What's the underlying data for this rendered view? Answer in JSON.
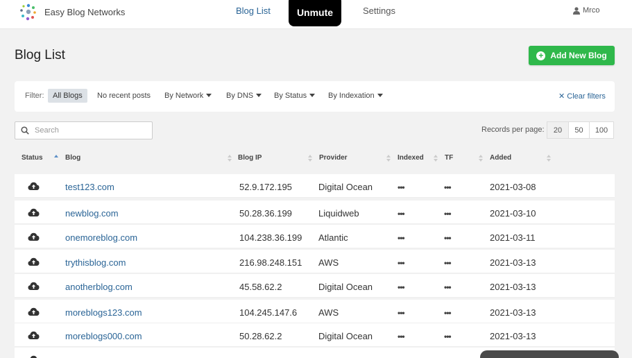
{
  "nav": {
    "brand": "Easy Blog Networks",
    "blog_list": "Blog List",
    "unmute": "Unmute",
    "settings": "Settings",
    "user": "Mrco"
  },
  "header": {
    "title": "Blog List",
    "add_button": "Add New Blog"
  },
  "filters": {
    "label": "Filter:",
    "all": "All Blogs",
    "no_recent": "No recent posts",
    "by_network": "By Network",
    "by_dns": "By DNS",
    "by_status": "By Status",
    "by_indexation": "By Indexation",
    "clear": "Clear filters"
  },
  "search": {
    "placeholder": "Search"
  },
  "records": {
    "label": "Records per page:",
    "options": [
      "20",
      "50",
      "100"
    ],
    "selected": "20"
  },
  "table": {
    "headers": {
      "status": "Status",
      "blog": "Blog",
      "ip": "Blog IP",
      "provider": "Provider",
      "indexed": "Indexed",
      "tf": "TF",
      "added": "Added"
    },
    "indexed_placeholder": "•••",
    "tf_placeholder": "•••",
    "rows": [
      {
        "blog": "test123.com",
        "ip": "52.9.172.195",
        "provider": "Digital Ocean",
        "added": "2021-03-08"
      },
      {
        "blog": "newblog.com",
        "ip": "50.28.36.199",
        "provider": "Liquidweb",
        "added": "2021-03-10"
      },
      {
        "blog": "onemoreblog.com",
        "ip": "104.238.36.199",
        "provider": "Atlantic",
        "added": "2021-03-11"
      },
      {
        "blog": "trythisblog.com",
        "ip": "216.98.248.151",
        "provider": "AWS",
        "added": "2021-03-13"
      },
      {
        "blog": "anotherblog.com",
        "ip": "45.58.62.2",
        "provider": "Digital Ocean",
        "added": "2021-03-13"
      },
      {
        "blog": "moreblogs123.com",
        "ip": "104.245.147.6",
        "provider": "AWS",
        "added": "2021-03-13"
      },
      {
        "blog": "moreblogs000.com",
        "ip": "50.28.62.2",
        "provider": "Digital Ocean",
        "added": "2021-03-13"
      }
    ]
  },
  "colors": {
    "accent_green": "#2fb84b",
    "link_blue": "#2a6496",
    "background": "#f2f2f2"
  }
}
